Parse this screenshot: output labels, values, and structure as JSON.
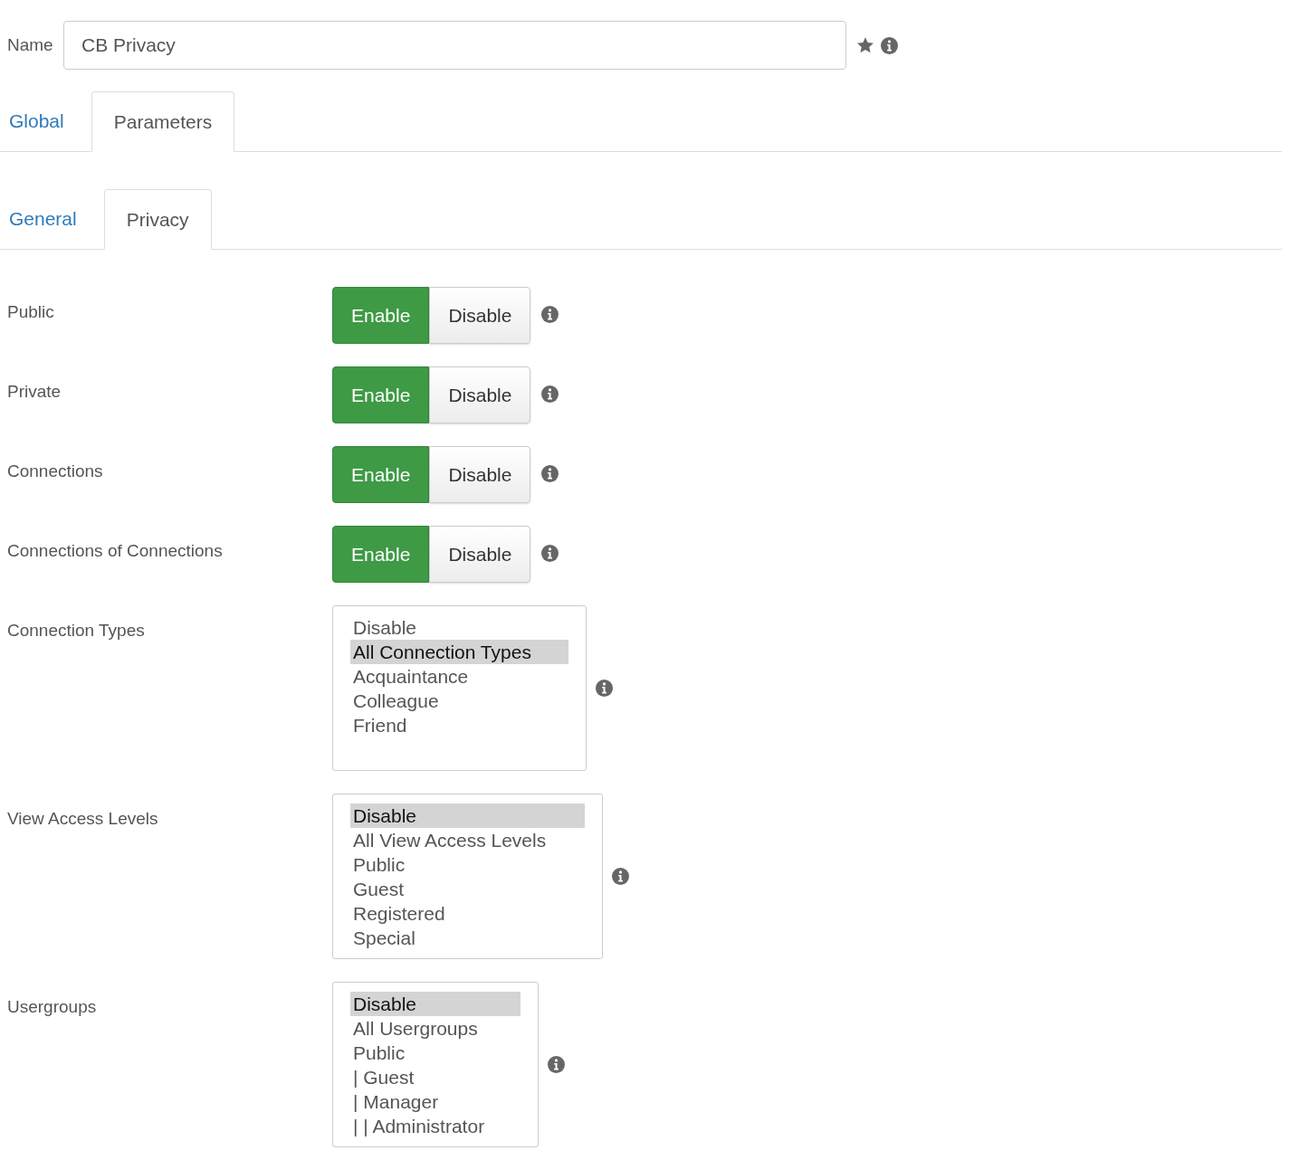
{
  "name_field": {
    "label": "Name",
    "value": "CB Privacy"
  },
  "tabs": [
    {
      "label": "Global",
      "selected": false
    },
    {
      "label": "Parameters",
      "selected": true
    }
  ],
  "subtabs": [
    {
      "label": "General",
      "selected": false
    },
    {
      "label": "Privacy",
      "selected": true
    }
  ],
  "fields": [
    {
      "kind": "toggle",
      "label": "Public",
      "options": [
        {
          "label": "Enable",
          "selected": true
        },
        {
          "label": "Disable",
          "selected": false
        }
      ]
    },
    {
      "kind": "toggle",
      "label": "Private",
      "options": [
        {
          "label": "Enable",
          "selected": true
        },
        {
          "label": "Disable",
          "selected": false
        }
      ]
    },
    {
      "kind": "toggle",
      "label": "Connections",
      "options": [
        {
          "label": "Enable",
          "selected": true
        },
        {
          "label": "Disable",
          "selected": false
        }
      ]
    },
    {
      "kind": "toggle",
      "label": "Connections of Connections",
      "options": [
        {
          "label": "Enable",
          "selected": true
        },
        {
          "label": "Disable",
          "selected": false
        }
      ]
    },
    {
      "kind": "listbox",
      "label": "Connection Types",
      "options": [
        {
          "label": "Disable",
          "selected": false
        },
        {
          "label": "All Connection Types",
          "selected": true
        },
        {
          "label": "Acquaintance",
          "selected": false
        },
        {
          "label": "Colleague",
          "selected": false
        },
        {
          "label": "Friend",
          "selected": false
        }
      ]
    },
    {
      "kind": "listbox",
      "label": "View Access Levels",
      "options": [
        {
          "label": "Disable",
          "selected": true
        },
        {
          "label": "All View Access Levels",
          "selected": false
        },
        {
          "label": "Public",
          "selected": false
        },
        {
          "label": "Guest",
          "selected": false
        },
        {
          "label": "Registered",
          "selected": false
        },
        {
          "label": "Special",
          "selected": false
        }
      ]
    },
    {
      "kind": "listbox",
      "label": "Usergroups",
      "options": [
        {
          "label": "Disable",
          "selected": true
        },
        {
          "label": "All Usergroups",
          "selected": false
        },
        {
          "label": "Public",
          "selected": false
        },
        {
          "label": "| Guest",
          "selected": false
        },
        {
          "label": "| Manager",
          "selected": false
        },
        {
          "label": "| | Administrator",
          "selected": false
        }
      ]
    }
  ]
}
